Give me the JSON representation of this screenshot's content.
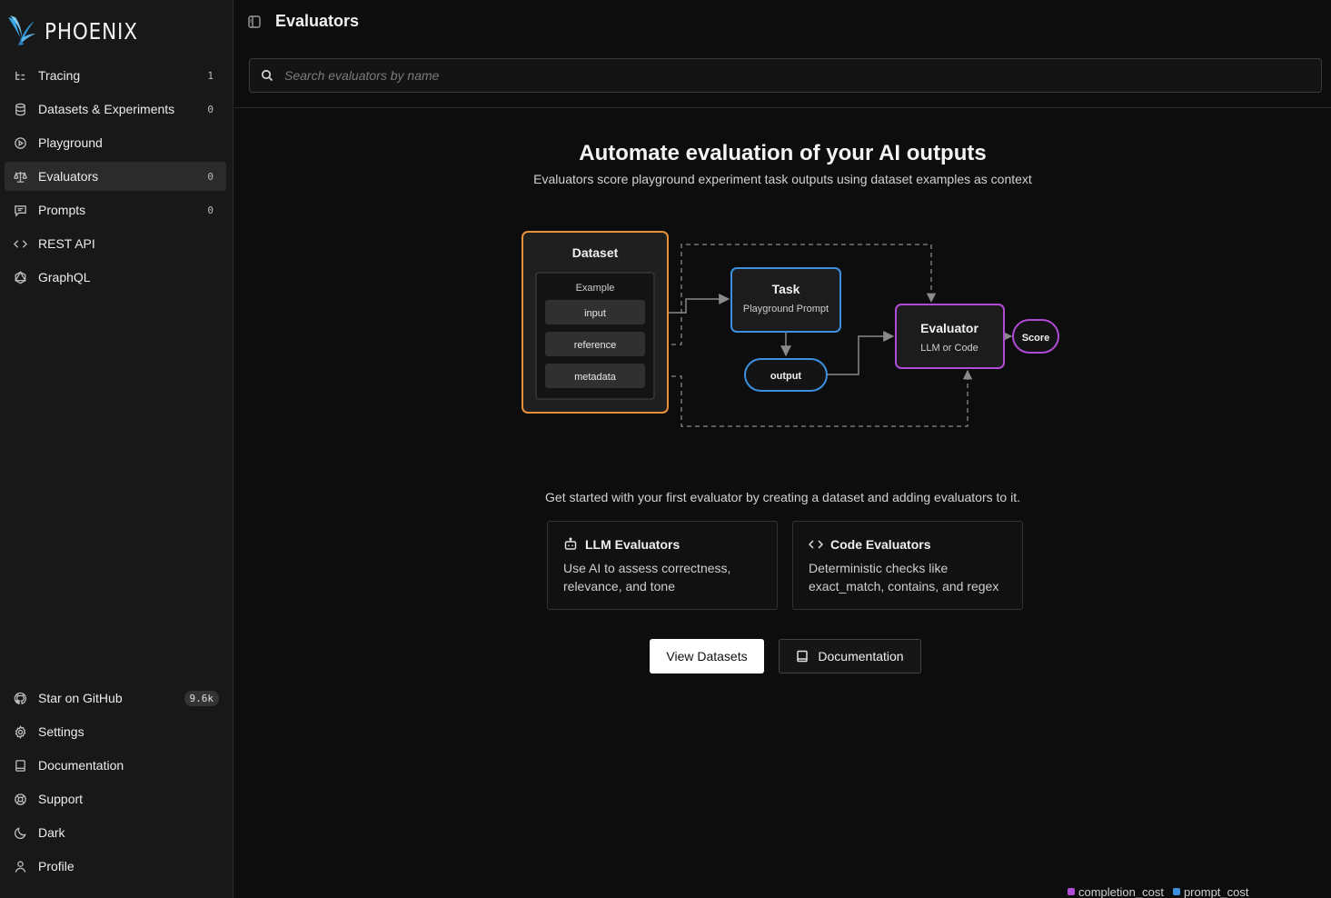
{
  "app": {
    "name": "PHOENIX"
  },
  "sidebar": {
    "top_items": [
      {
        "label": "Tracing",
        "count": "1",
        "icon": "tracing-icon"
      },
      {
        "label": "Datasets & Experiments",
        "count": "0",
        "icon": "database-icon"
      },
      {
        "label": "Playground",
        "count": "",
        "icon": "playground-icon"
      },
      {
        "label": "Evaluators",
        "count": "0",
        "icon": "scale-icon",
        "active": true
      },
      {
        "label": "Prompts",
        "count": "0",
        "icon": "chat-icon"
      },
      {
        "label": "REST API",
        "count": "",
        "icon": "code-icon"
      },
      {
        "label": "GraphQL",
        "count": "",
        "icon": "graphql-icon"
      }
    ],
    "bottom_items": [
      {
        "label": "Star on GitHub",
        "badge": "9.6k",
        "icon": "github-icon"
      },
      {
        "label": "Settings",
        "icon": "gear-icon"
      },
      {
        "label": "Documentation",
        "icon": "book-icon"
      },
      {
        "label": "Support",
        "icon": "lifebuoy-icon"
      },
      {
        "label": "Dark",
        "icon": "moon-icon"
      },
      {
        "label": "Profile",
        "icon": "user-icon"
      }
    ]
  },
  "header": {
    "title": "Evaluators"
  },
  "search": {
    "placeholder": "Search evaluators by name",
    "value": ""
  },
  "hero": {
    "title": "Automate evaluation of your AI outputs",
    "subtitle": "Evaluators score playground experiment task outputs using dataset examples as context"
  },
  "diagram": {
    "dataset_title": "Dataset",
    "example_title": "Example",
    "fields": [
      "input",
      "reference",
      "metadata"
    ],
    "task_title": "Task",
    "task_sub": "Playground Prompt",
    "output_label": "output",
    "evaluator_title": "Evaluator",
    "evaluator_sub": "LLM or Code",
    "score_label": "Score",
    "colors": {
      "dataset": "#e8913a",
      "task": "#3d8fe0",
      "evaluator": "#b04bd6",
      "connector": "#8a8a8a"
    }
  },
  "get_started": "Get started with your first evaluator by creating a dataset and adding evaluators to it.",
  "cards": [
    {
      "title": "LLM Evaluators",
      "description": "Use AI to assess correctness, relevance, and tone",
      "icon": "robot-icon"
    },
    {
      "title": "Code Evaluators",
      "description": "Deterministic checks like exact_match, contains, and regex",
      "icon": "code-icon"
    }
  ],
  "buttons": {
    "view_datasets": "View Datasets",
    "documentation": "Documentation"
  },
  "legend": [
    {
      "label": "completion_cost",
      "color": "#b04bd6"
    },
    {
      "label": "prompt_cost",
      "color": "#3d8fe0"
    }
  ]
}
